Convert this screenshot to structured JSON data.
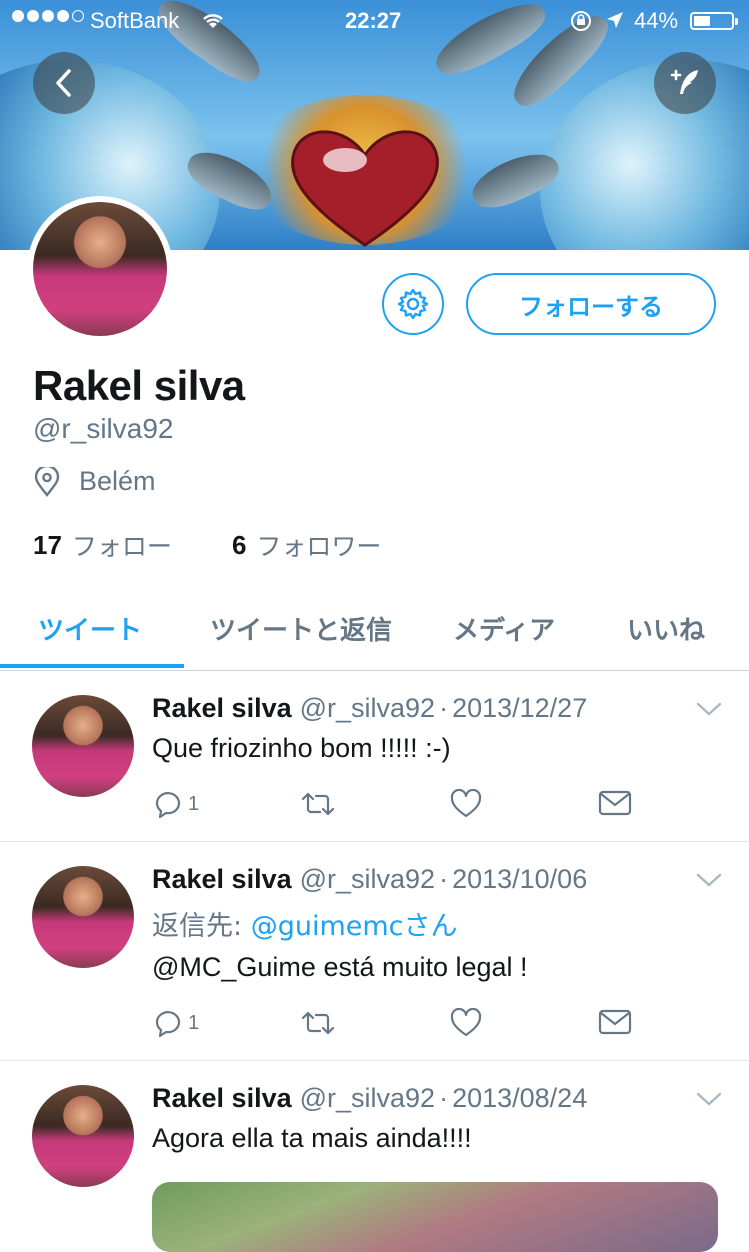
{
  "status_bar": {
    "carrier": "SoftBank",
    "time": "22:27",
    "battery": "44%"
  },
  "profile": {
    "name": "Rakel silva",
    "handle": "@r_silva92",
    "location": "Belém",
    "following_count": "17",
    "following_label": "フォロー",
    "followers_count": "6",
    "followers_label": "フォロワー",
    "follow_button": "フォローする"
  },
  "tabs": [
    {
      "label": "ツイート",
      "active": true
    },
    {
      "label": "ツイートと返信",
      "active": false
    },
    {
      "label": "メディア",
      "active": false
    },
    {
      "label": "いいね",
      "active": false
    }
  ],
  "tweets": [
    {
      "name": "Rakel silva",
      "handle": "@r_silva92",
      "date": "2013/12/27",
      "text": "Que friozinho bom !!!!! :-)",
      "reply_count": "1"
    },
    {
      "name": "Rakel silva",
      "handle": "@r_silva92",
      "date": "2013/10/06",
      "reply_prefix": "返信先: ",
      "reply_to": "@guimemcさん",
      "text": "@MC_Guime está muito legal !",
      "reply_count": "1"
    },
    {
      "name": "Rakel silva",
      "handle": "@r_silva92",
      "date": "2013/08/24",
      "text": "Agora ella ta mais ainda!!!!"
    }
  ],
  "colors": {
    "accent": "#1da1f2",
    "muted": "#657786",
    "text": "#14171a"
  }
}
